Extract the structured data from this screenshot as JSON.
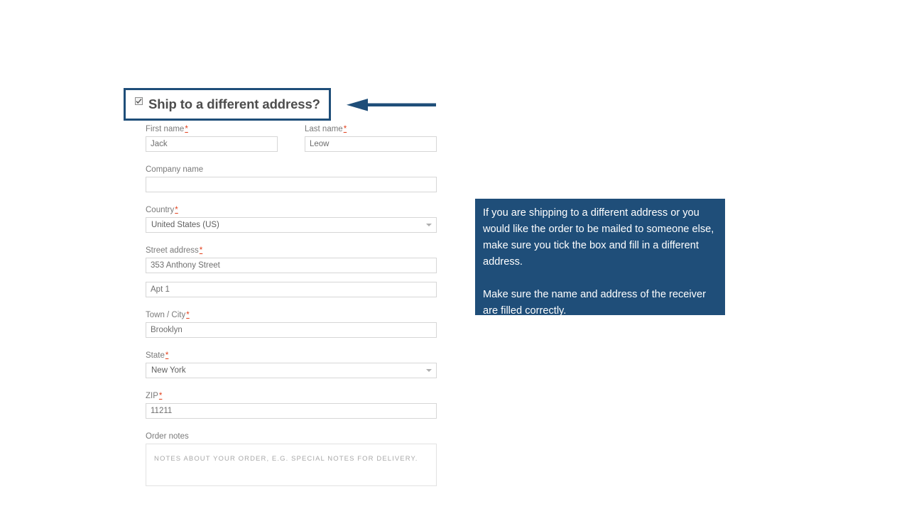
{
  "heading": {
    "label": "Ship to a different address?",
    "checkbox_checked": true,
    "checkbox_icon": "checkmark-icon",
    "highlight_border_color": "#1F4E79"
  },
  "arrow": {
    "icon": "arrow-left-icon",
    "color": "#1F4E79",
    "direction": "left"
  },
  "form": {
    "first_name": {
      "label": "First name",
      "required_marker": "*",
      "value": "Jack",
      "placeholder": ""
    },
    "last_name": {
      "label": "Last name",
      "required_marker": "*",
      "value": "Leow",
      "placeholder": ""
    },
    "company_name": {
      "label": "Company name",
      "required_marker": "",
      "value": "",
      "placeholder": ""
    },
    "country": {
      "label": "Country",
      "required_marker": "*",
      "value": "United States (US)",
      "caret_icon": "chevron-down-icon"
    },
    "street_address": {
      "label": "Street address",
      "required_marker": "*",
      "value": "353 Anthony Street",
      "placeholder": ""
    },
    "street_address_2": {
      "label": "",
      "value": "Apt 1",
      "placeholder": ""
    },
    "town_city": {
      "label": "Town / City",
      "required_marker": "*",
      "value": "Brooklyn",
      "placeholder": ""
    },
    "state": {
      "label": "State",
      "required_marker": "*",
      "value": "New York",
      "caret_icon": "chevron-down-icon"
    },
    "zip": {
      "label": "ZIP",
      "required_marker": "*",
      "value": "11211",
      "placeholder": ""
    },
    "order_notes": {
      "label": "Order notes",
      "required_marker": "",
      "value": "",
      "placeholder": "NOTES ABOUT YOUR ORDER, E.G. SPECIAL NOTES FOR DELIVERY."
    }
  },
  "info_callout": {
    "background_color": "#1F4E79",
    "paragraph_1": "If you are shipping to a different address or you would like the order to be mailed to someone else, make sure you tick the box and fill in a different address.",
    "paragraph_2": "Make sure the name and address of the receiver are filled correctly."
  }
}
